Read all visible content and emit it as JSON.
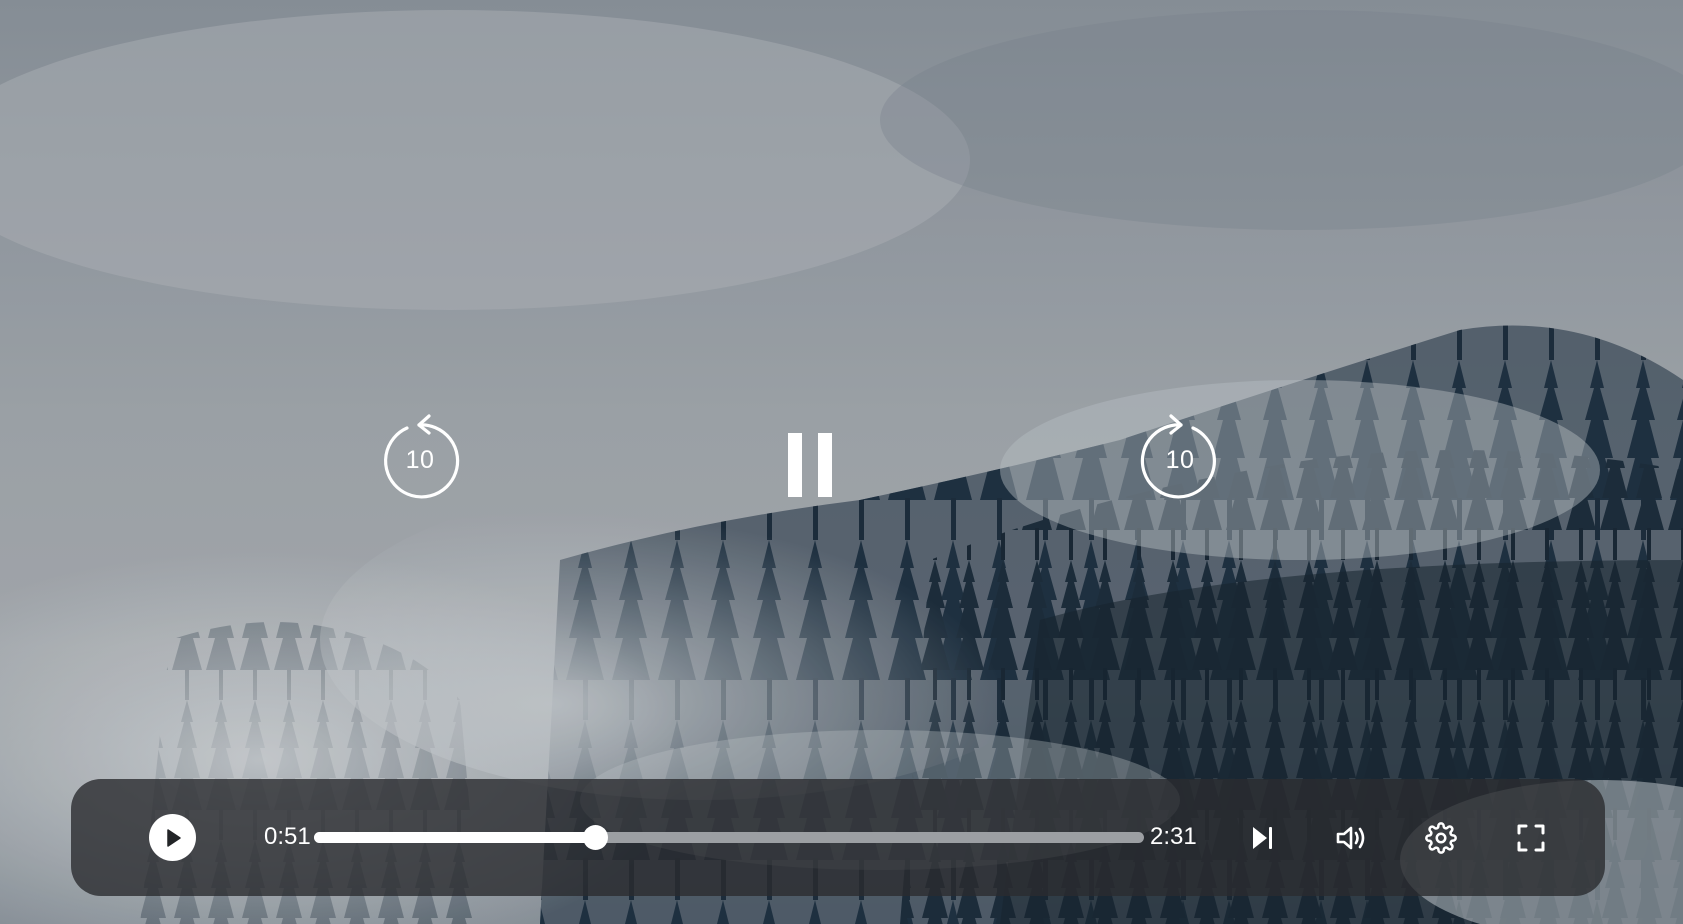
{
  "player": {
    "current_time": "0:51",
    "total_time": "2:31",
    "progress_fraction": 0.338,
    "rewind_seconds": "10",
    "forward_seconds": "10",
    "state": "playing"
  },
  "icons": {
    "rewind": "rotate-ccw-icon",
    "forward": "rotate-cw-icon",
    "pause": "pause-icon",
    "play": "play-icon",
    "next": "skip-next-icon",
    "volume": "volume-icon",
    "settings": "gear-icon",
    "fullscreen": "fullscreen-icon"
  },
  "colors": {
    "control_bar": "#2a2c30",
    "accent": "#ffffff",
    "track": "#9c9fa3"
  }
}
